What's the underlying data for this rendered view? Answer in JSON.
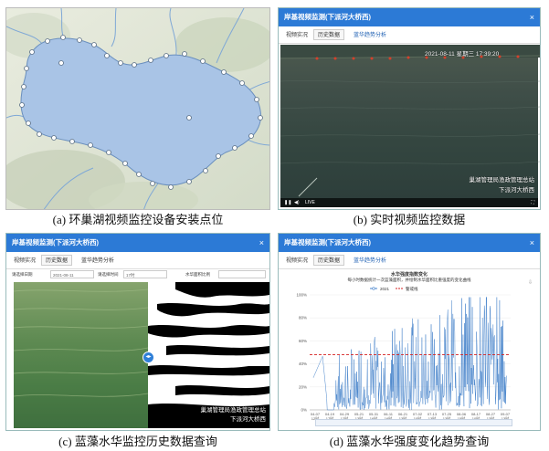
{
  "captions": {
    "a": "(a) 环巢湖视频监控设备安装点位",
    "b": "(b) 实时视频监控数据",
    "c": "(c) 蓝藻水华监控历史数据查询",
    "d": "(d) 蓝藻水华强度变化趋势查询"
  },
  "window": {
    "title": "岸基视频监测(下派河大桥西)",
    "close": "×",
    "tabs": [
      "视频实况",
      "历史数据",
      "蓝华趋势分析"
    ]
  },
  "video": {
    "timestamp": "2021-08-11 星期三 17:39:20",
    "watermark_line1": "巢湖管理局渔政管理总站",
    "watermark_line2": "下派河大桥西",
    "live_label": "LIVE",
    "colors": {
      "buoy": "#d6402b"
    }
  },
  "history": {
    "date_label": "请选择日期",
    "date_value": "2021-08-11",
    "time_label": "请选择时间",
    "time_value": "17时",
    "ratio_label": "水华面积比例",
    "watermark_line1": "巢湖管理局渔政管理总站",
    "watermark_line2": "下派河大桥西",
    "handle_icon": "◂▸"
  },
  "chart_data": {
    "type": "line",
    "title": "水华强度指数变化",
    "subtitle": "每小时数据统计一次蓝藻面积，并绘制水华面积比重强度的变化曲线",
    "series": [
      {
        "name": "2021",
        "color": "#4a86cc"
      },
      {
        "name": "警戒线",
        "color": "#d62020",
        "value": 48
      }
    ],
    "ylim": [
      0,
      100
    ],
    "yticks": [
      "0%",
      "20%",
      "40%",
      "60%",
      "80%",
      "100%"
    ],
    "xticks": [
      "04-07 12时",
      "04-19 17时",
      "04-29 12时",
      "05-21 13时",
      "05-31 16时",
      "06-11 16时",
      "06-21 13时",
      "07-02 10时",
      "07-13 13时",
      "07-25 13时",
      "08-06 15时",
      "08-17 10时",
      "08-27 13时",
      "09-07 13时"
    ],
    "download_icon": "⇩"
  }
}
